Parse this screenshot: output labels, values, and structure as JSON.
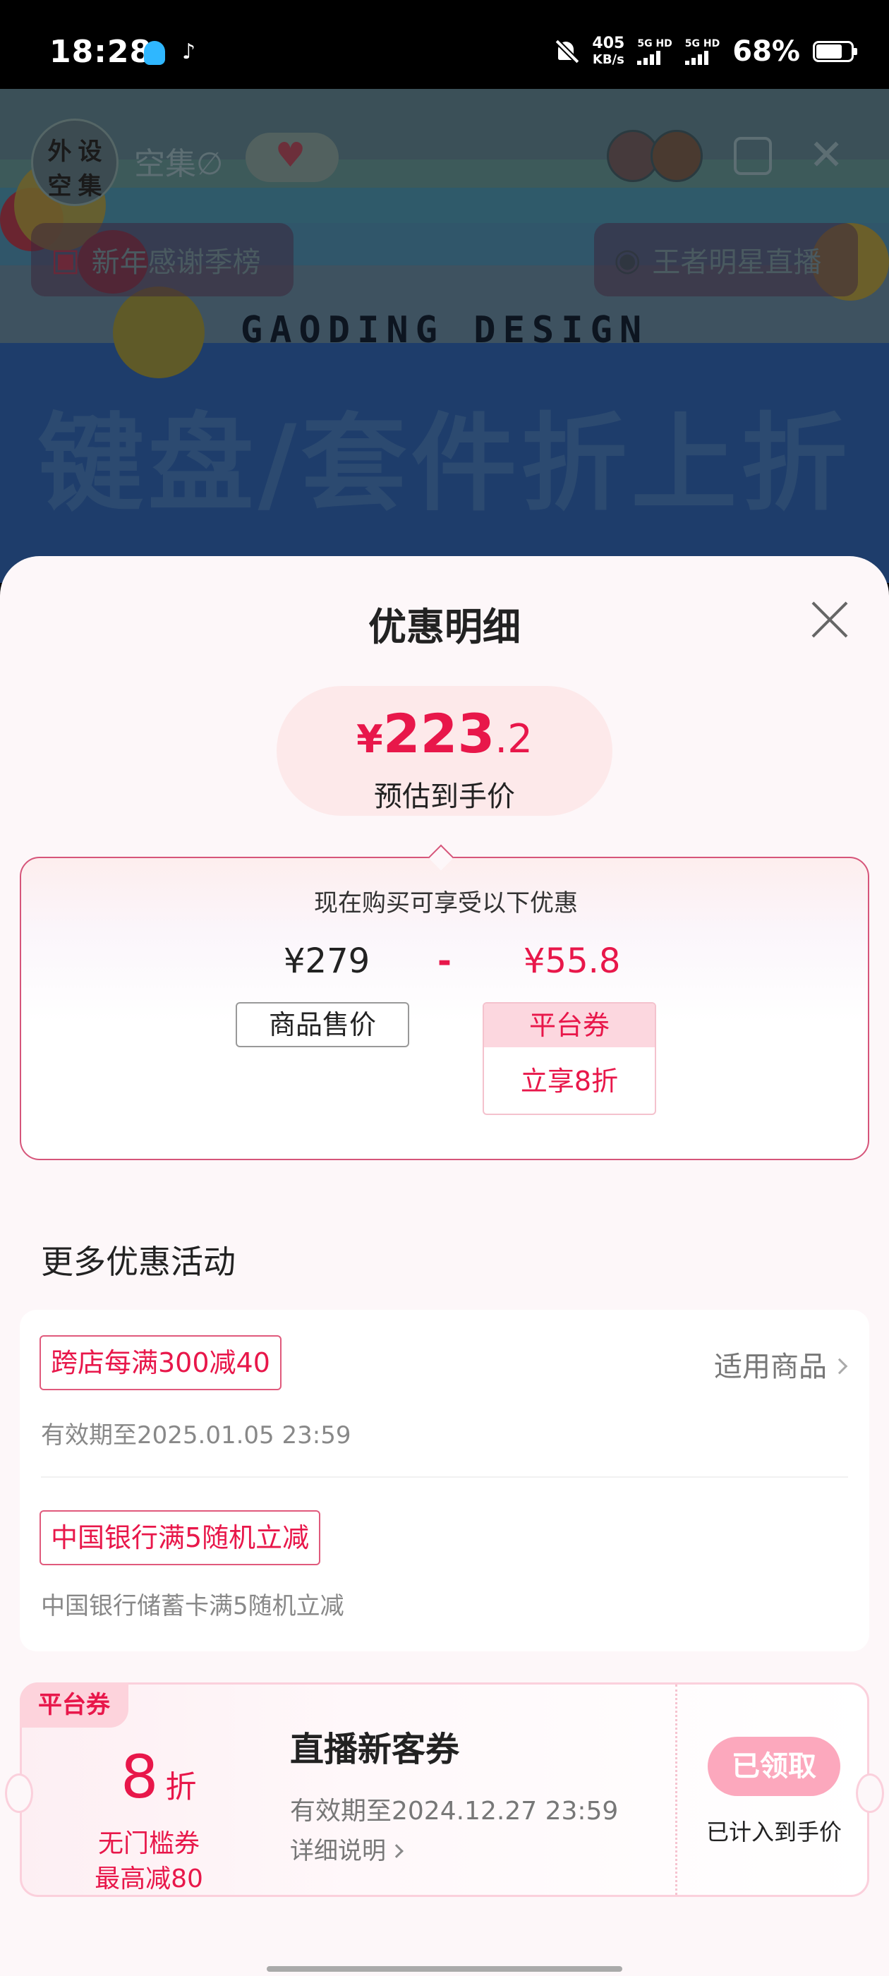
{
  "status_bar": {
    "time": "18:28",
    "speed_value": "405",
    "speed_unit": "KB/s",
    "sim1_label": "5G HD",
    "sim2_label": "5G HD",
    "battery": "68%"
  },
  "live_room": {
    "host_avatar_chars": [
      "外",
      "设",
      "空",
      "集"
    ],
    "host_name": "空集∅",
    "pill_left": "新年感谢季榜",
    "pill_right": "王者明星直播",
    "brand": "GAODING DESIGN",
    "banner": "键盘/套件折上折"
  },
  "sheet": {
    "title": "优惠明细",
    "final_price": {
      "symbol": "¥",
      "integer": "223",
      "decimal": ".2",
      "label": "预估到手价"
    },
    "detail": {
      "heading": "现在购买可享受以下优惠",
      "original_amount": "¥279",
      "original_label": "商品售价",
      "minus": "-",
      "coupon_amount": "¥55.8",
      "coupon_type": "平台券",
      "coupon_desc": "立享8折"
    },
    "more_title": "更多优惠活动",
    "promos": [
      {
        "tag": "跨店每满300减40",
        "link": "适用商品",
        "sub": "有效期至2025.01.05 23:59"
      },
      {
        "tag": "中国银行满5随机立减",
        "sub": "中国银行储蓄卡满5随机立减"
      }
    ],
    "coupon": {
      "badge": "平台券",
      "value": "8",
      "unit": "折",
      "cond1": "无门槛券",
      "cond2": "最高减80",
      "name": "直播新客券",
      "valid": "有效期至2024.12.27 23:59",
      "detail_link": "详细说明",
      "button": "已领取",
      "note": "已计入到手价"
    }
  },
  "colors": {
    "accent": "#e8174a",
    "accent_soft": "#fde9ea",
    "button_pink": "#fca8bd"
  }
}
